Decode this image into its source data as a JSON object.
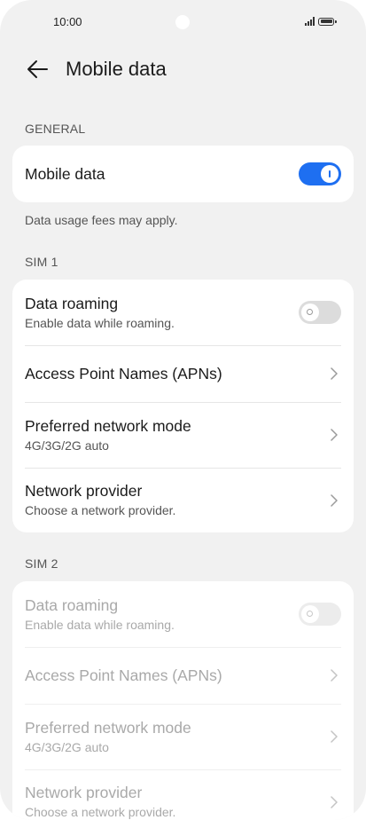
{
  "status_bar": {
    "time": "10:00"
  },
  "header": {
    "title": "Mobile data",
    "back_icon": "arrow-left-icon"
  },
  "general": {
    "label": "GENERAL",
    "mobile_data": {
      "title": "Mobile data",
      "enabled": true
    },
    "helper": "Data usage fees may apply."
  },
  "sim1": {
    "label": "SIM 1",
    "data_roaming": {
      "title": "Data roaming",
      "subtitle": "Enable data while roaming.",
      "enabled": false
    },
    "apns": {
      "title": "Access Point Names (APNs)"
    },
    "network_mode": {
      "title": "Preferred network mode",
      "subtitle": "4G/3G/2G auto"
    },
    "network_provider": {
      "title": "Network provider",
      "subtitle": "Choose a network provider."
    }
  },
  "sim2": {
    "label": "SIM 2",
    "data_roaming": {
      "title": "Data roaming",
      "subtitle": "Enable data while roaming.",
      "enabled": false
    },
    "apns": {
      "title": "Access Point Names (APNs)"
    },
    "network_mode": {
      "title": "Preferred network mode",
      "subtitle": "4G/3G/2G auto"
    },
    "network_provider": {
      "title": "Network provider",
      "subtitle": "Choose a network provider."
    }
  },
  "colors": {
    "accent": "#1e6ff1",
    "background": "#f1f1f1",
    "card": "#ffffff",
    "disabled_text": "#a9a9a9"
  }
}
